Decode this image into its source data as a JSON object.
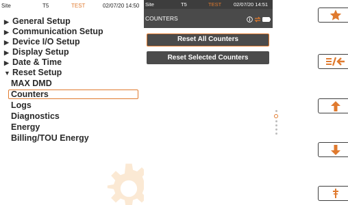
{
  "left_status": {
    "site": "Site",
    "device": "T5",
    "mode": "TEST",
    "datetime": "02/07/20 14:50"
  },
  "menu": [
    {
      "label": "General Setup",
      "state": "collapsed"
    },
    {
      "label": "Communication Setup",
      "state": "collapsed"
    },
    {
      "label": "Device I/O Setup",
      "state": "collapsed"
    },
    {
      "label": "Display Setup",
      "state": "collapsed"
    },
    {
      "label": "Date & Time",
      "state": "collapsed"
    },
    {
      "label": "Reset Setup",
      "state": "expanded"
    }
  ],
  "submenu": [
    "MAX DMD",
    "Counters",
    "Logs",
    "Diagnostics",
    "Energy",
    "Billing/TOU Energy"
  ],
  "selected_submenu": "Counters",
  "mid_status": {
    "site": "Site",
    "device": "T5",
    "mode": "TEST",
    "datetime": "02/07/20 14:51"
  },
  "screen_title": "COUNTERS",
  "actions": {
    "reset_all": "Reset All Counters",
    "reset_selected": "Reset Selected Counters"
  },
  "pager": {
    "total": 6,
    "current": 1
  },
  "side_buttons": [
    "star-icon",
    "menu-back-icon",
    "arrow-up-icon",
    "arrow-down-icon",
    "dagger-icon"
  ],
  "colors": {
    "accent": "#e07a2e",
    "title_bar": "#4a4a4a",
    "text": "#2a2a2a"
  }
}
